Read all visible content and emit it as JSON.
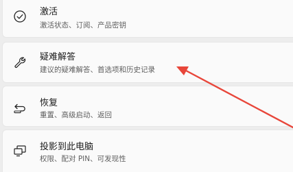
{
  "items": [
    {
      "icon": "check-circle-icon",
      "title": "激活",
      "subtitle": "激活状态、订阅、产品密钥"
    },
    {
      "icon": "wrench-icon",
      "title": "疑难解答",
      "subtitle": "建议的疑难解答、首选项和历史记录"
    },
    {
      "icon": "recovery-icon",
      "title": "恢复",
      "subtitle": "重置、高级启动、返回"
    },
    {
      "icon": "project-screen-icon",
      "title": "投影到此电脑",
      "subtitle": "权限、配对 PIN、可发现性"
    }
  ],
  "colors": {
    "annotation_arrow": "#e8463a",
    "card_background": "#fafafa",
    "page_background": "#ededed"
  }
}
